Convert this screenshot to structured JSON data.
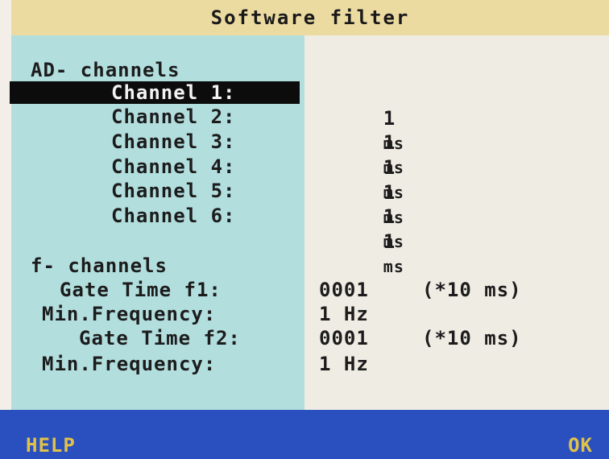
{
  "window": {
    "title": "Software filter"
  },
  "ad_section": {
    "heading": "AD- channels",
    "channels": [
      {
        "label": "Channel 1:",
        "value": "1",
        "unit": "ms"
      },
      {
        "label": "Channel 2:",
        "value": "1",
        "unit": "ms"
      },
      {
        "label": "Channel 3:",
        "value": "1",
        "unit": "ms"
      },
      {
        "label": "Channel 4:",
        "value": "1",
        "unit": "ms"
      },
      {
        "label": "Channel 5:",
        "value": "1",
        "unit": "ms"
      },
      {
        "label": "Channel 6:",
        "value": "1",
        "unit": "ms"
      }
    ]
  },
  "f_section": {
    "heading": "f- channels",
    "rows": [
      {
        "label": "Gate Time f1:",
        "value": "0001",
        "note": "(*10 ms)"
      },
      {
        "label": "Min.Frequency:",
        "value": "1 Hz",
        "note": ""
      },
      {
        "label": "Gate Time f2:",
        "value": "0001",
        "note": "(*10 ms)"
      },
      {
        "label": "Min.Frequency:",
        "value": "1 Hz",
        "note": ""
      }
    ]
  },
  "footer": {
    "help_label": "HELP",
    "ok_label": "OK"
  },
  "colors": {
    "title_bg": "#ecdba1",
    "left_panel_bg": "#b3dede",
    "right_panel_bg": "#efece4",
    "footer_bg": "#2a4fbf",
    "footer_text": "#e0c24a",
    "selection_bg": "#0c0c0c"
  }
}
